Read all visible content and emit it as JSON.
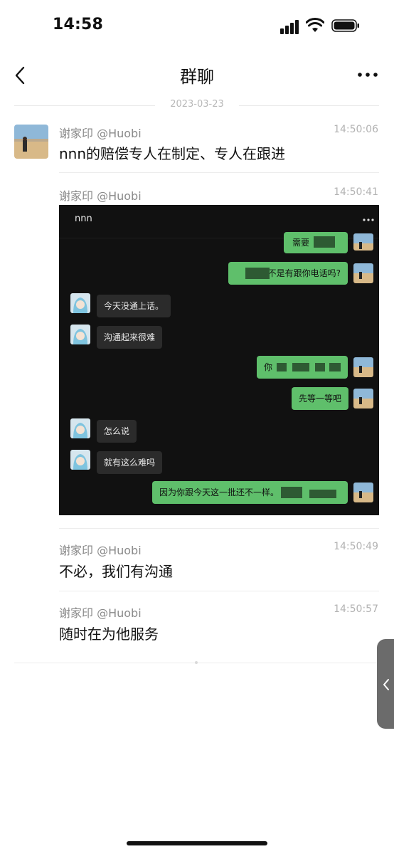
{
  "status_bar": {
    "time": "14:58",
    "icons": [
      "signal-icon",
      "wifi-icon",
      "battery-icon"
    ]
  },
  "nav": {
    "title": "群聊",
    "back_icon": "chevron-left-icon",
    "more_icon": "more-icon"
  },
  "date_separator": "2023-03-23",
  "messages": [
    {
      "sender": "谢家印 @Huobi",
      "time": "14:50:06",
      "text": "nnn的赔偿专人在制定、专人在跟进"
    },
    {
      "sender": "谢家印 @Huobi",
      "time": "14:50:41",
      "type": "image"
    },
    {
      "sender": "谢家印 @Huobi",
      "time": "14:50:49",
      "text": "不必，我们有沟通"
    },
    {
      "sender": "谢家印 @Huobi",
      "time": "14:50:57",
      "text": "随时在为他服务"
    }
  ],
  "embedded_screenshot": {
    "title": "nnn",
    "bubbles": [
      {
        "side": "right",
        "text": "需要"
      },
      {
        "side": "right",
        "text": "不是有跟你电话吗?"
      },
      {
        "side": "left",
        "text": "今天没通上话。"
      },
      {
        "side": "left",
        "text": "沟通起来很难"
      },
      {
        "side": "right",
        "text": "你"
      },
      {
        "side": "right",
        "text": "先等一等吧"
      },
      {
        "side": "left",
        "text": "怎么说"
      },
      {
        "side": "left",
        "text": "就有这么难吗"
      },
      {
        "side": "right",
        "text": "因为你跟今天这一批还不一样。"
      }
    ]
  },
  "colors": {
    "bubble_green": "#5fbf6b",
    "bubble_dark": "#2b2b2b",
    "side_tab": "#6b6b6b"
  },
  "side_tab_icon": "chevron-left-icon"
}
